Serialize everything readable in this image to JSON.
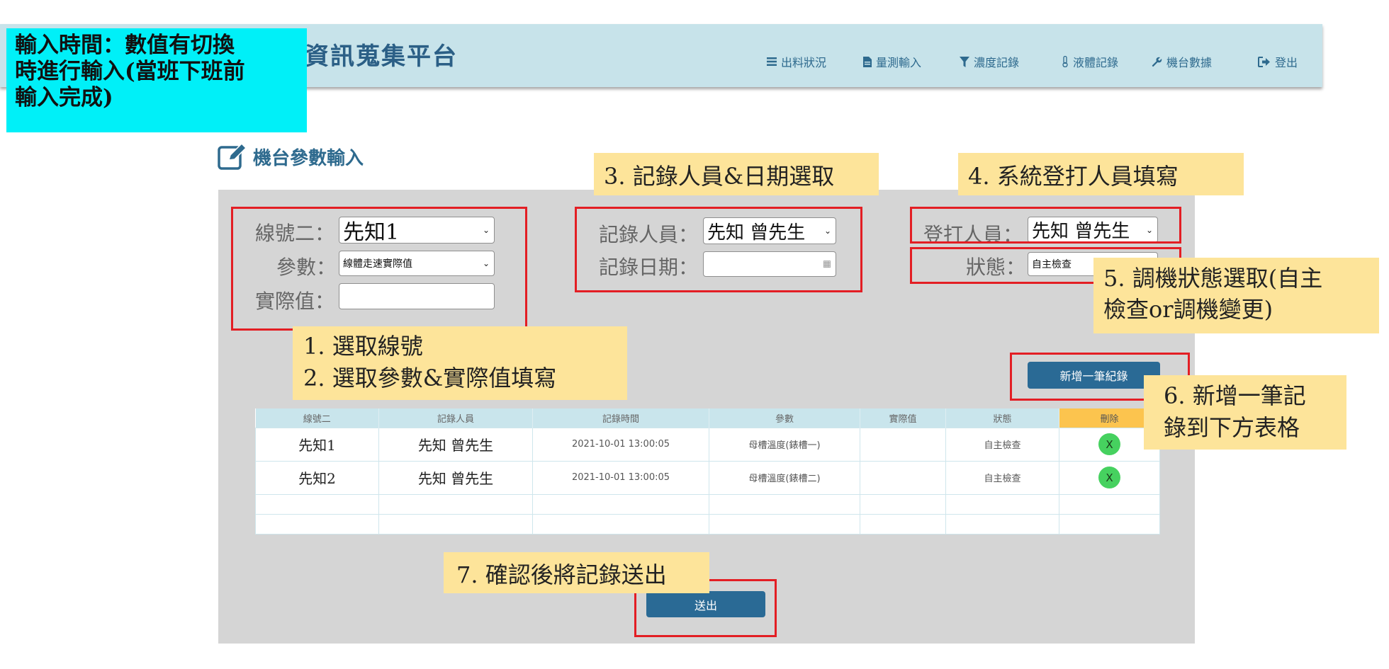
{
  "header": {
    "site_title": "資訊蒐集平台",
    "nav": [
      {
        "label": "出料狀況",
        "icon": "list-icon"
      },
      {
        "label": "量測輸入",
        "icon": "file-icon"
      },
      {
        "label": "濃度記錄",
        "icon": "filter-icon"
      },
      {
        "label": "液體記錄",
        "icon": "thermometer-icon"
      },
      {
        "label": "機台數據",
        "icon": "wrench-icon"
      },
      {
        "label": "登出",
        "icon": "sign-out-icon"
      }
    ]
  },
  "page_title": "機台參數輸入",
  "form": {
    "line_label": "線號二：",
    "line_value": "先知1",
    "param_label": "參數：",
    "param_value": "線體走速實際值",
    "actual_label": "實際值：",
    "actual_value": "",
    "recorder_label": "記錄人員：",
    "recorder_value": "先知 曾先生",
    "date_label": "記錄日期：",
    "date_value": "",
    "operator_label": "登打人員：",
    "operator_value": "先知 曾先生",
    "status_label": "狀態：",
    "status_value": "自主檢查"
  },
  "add_button": "新增一筆紀錄",
  "submit_button": "送出",
  "table": {
    "headers": [
      "線號二",
      "記錄人員",
      "記錄時間",
      "參數",
      "實際值",
      "狀態",
      "刪除"
    ],
    "rows": [
      {
        "line": "先知1",
        "recorder": "先知 曾先生",
        "time": "2021-10-01 13:00:05",
        "param": "母槽溫度(錶槽一)",
        "actual": "",
        "status": "自主檢查",
        "delete": "X"
      },
      {
        "line": "先知2",
        "recorder": "先知 曾先生",
        "time": "2021-10-01 13:00:05",
        "param": "母槽溫度(錶槽二)",
        "actual": "",
        "status": "自主檢查",
        "delete": "X"
      }
    ]
  },
  "annotations": {
    "top_left": [
      "輸入時間：數值有切換",
      "時進行輸入(當班下班前",
      "輸入完成)"
    ],
    "step1": "1.   選取線號",
    "step2": "2.   選取參數&實際值填寫",
    "step3": "3. 記錄人員&日期選取",
    "step4": "4. 系統登打人員填寫",
    "step5": [
      "5. 調機狀態選取(自主",
      "檢查or調機變更)"
    ],
    "step6": [
      "6. 新增一筆記",
      "錄到下方表格"
    ],
    "step7": "7. 確認後將記錄送出"
  },
  "colors": {
    "header_bg": "#c7e3ea",
    "panel_bg": "#d5d5d5",
    "note_bg": "#fde49a",
    "top_note_bg": "#00f0f8",
    "highlight": "#e31e24",
    "button": "#2a6a95",
    "delete_button": "#46d15f"
  }
}
